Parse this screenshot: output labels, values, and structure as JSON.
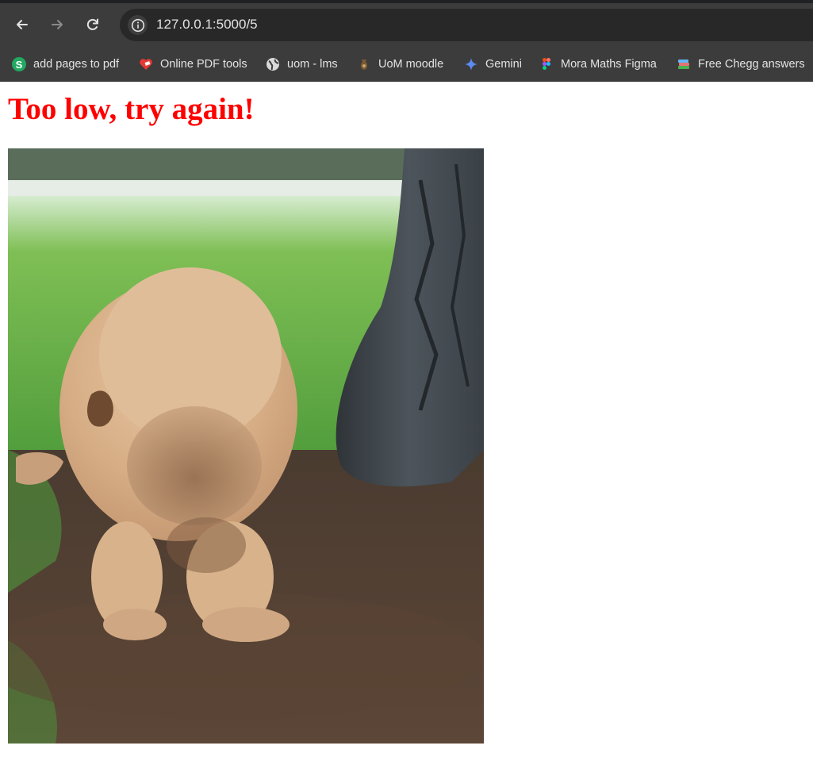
{
  "browser": {
    "url": "127.0.0.1:5000/5",
    "bookmarks": [
      {
        "label": "add pages to pdf",
        "icon": "s-logo-icon"
      },
      {
        "label": "Online PDF tools",
        "icon": "heart-pdf-icon"
      },
      {
        "label": "uom - lms",
        "icon": "globe-icon"
      },
      {
        "label": "UoM moodle",
        "icon": "moodle-icon"
      },
      {
        "label": "Gemini",
        "icon": "gemini-sparkle-icon"
      },
      {
        "label": "Mora Maths Figma",
        "icon": "figma-icon"
      },
      {
        "label": "Free Chegg answers",
        "icon": "books-icon"
      }
    ]
  },
  "page": {
    "message": "Too low, try again!",
    "message_color": "#ff0000",
    "image": "puppy-digging-gif"
  }
}
